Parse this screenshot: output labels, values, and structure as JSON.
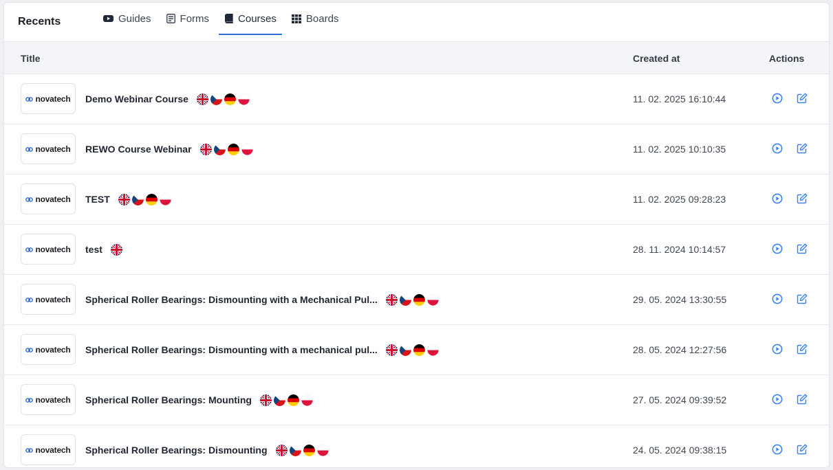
{
  "header": {
    "title": "Recents",
    "tabs": [
      {
        "label": "Guides",
        "icon": "youtube-icon"
      },
      {
        "label": "Forms",
        "icon": "form-icon"
      },
      {
        "label": "Courses",
        "icon": "book-icon",
        "active": true
      },
      {
        "label": "Boards",
        "icon": "grid-icon"
      }
    ]
  },
  "table": {
    "columns": {
      "title": "Title",
      "created": "Created at",
      "actions": "Actions"
    },
    "rows": [
      {
        "brand": "novatech",
        "title": "Demo Webinar Course",
        "flags": [
          "gb",
          "cz",
          "de",
          "pl"
        ],
        "created": "11. 02. 2025 16:10:44"
      },
      {
        "brand": "novatech",
        "title": "REWO Course Webinar",
        "flags": [
          "gb",
          "cz",
          "de",
          "pl"
        ],
        "created": "11. 02. 2025 10:10:35"
      },
      {
        "brand": "novatech",
        "title": "TEST",
        "flags": [
          "gb",
          "cz",
          "de",
          "pl"
        ],
        "created": "11. 02. 2025 09:28:23"
      },
      {
        "brand": "novatech",
        "title": "test",
        "flags": [
          "gb"
        ],
        "created": "28. 11. 2024 10:14:57"
      },
      {
        "brand": "novatech",
        "title": "Spherical Roller Bearings: Dismounting with a Mechanical Pul...",
        "flags": [
          "gb",
          "cz",
          "de",
          "pl"
        ],
        "created": "29. 05. 2024 13:30:55"
      },
      {
        "brand": "novatech",
        "title": "Spherical Roller Bearings: Dismounting with a mechanical pul...",
        "flags": [
          "gb",
          "cz",
          "de",
          "pl"
        ],
        "created": "28. 05. 2024 12:27:56"
      },
      {
        "brand": "novatech",
        "title": "Spherical Roller Bearings: Mounting",
        "flags": [
          "gb",
          "cz",
          "de",
          "pl"
        ],
        "created": "27. 05. 2024 09:39:52"
      },
      {
        "brand": "novatech",
        "title": "Spherical Roller Bearings: Dismounting",
        "flags": [
          "gb",
          "cz",
          "de",
          "pl"
        ],
        "created": "24. 05. 2024 09:38:15"
      }
    ]
  },
  "colors": {
    "accent": "#2f6fd6",
    "action": "#3b82f6"
  }
}
